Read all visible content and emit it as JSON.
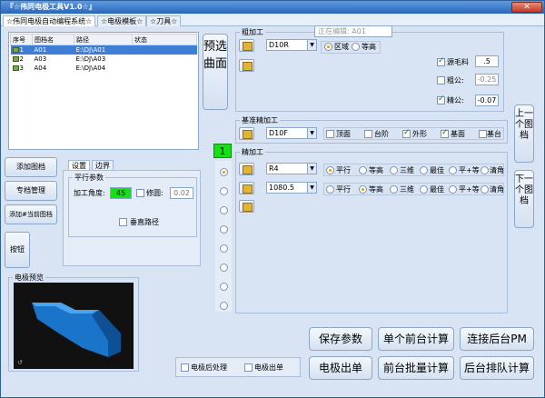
{
  "window": {
    "title": "『☆伟同电极工具V1.0☆』",
    "close": "✕"
  },
  "tabs": [
    "☆伟同电极自动编程系统☆",
    "☆电极模板☆",
    "☆刀具☆"
  ],
  "file_table": {
    "headers": [
      "序号",
      "图档名",
      "路径",
      "状态"
    ],
    "rows": [
      {
        "no": "1",
        "name": "A01",
        "path": "E:\\DJ\\A01",
        "status": ""
      },
      {
        "no": "2",
        "name": "A03",
        "path": "E:\\DJ\\A03",
        "status": ""
      },
      {
        "no": "3",
        "name": "A04",
        "path": "E:\\DJ\\A04",
        "status": ""
      }
    ]
  },
  "left_buttons": {
    "add": "添加图档",
    "manage": "专档管理",
    "add_current": "添加#当前图档",
    "button": "按钮"
  },
  "settings": {
    "tabs": [
      "设置",
      "边界"
    ],
    "group": "平行参数",
    "angle_label": "加工角度:",
    "angle_value": "45",
    "trim_label": "修圆:",
    "trim_value": "0.02",
    "vertical": "垂直路径"
  },
  "preview": {
    "label": "电极预览"
  },
  "preselect_button": "预选曲面",
  "step_number": "1",
  "rough": {
    "title": "粗加工",
    "editing": "正在编辑: A01",
    "tool": "D10R",
    "radio_area": "区域",
    "radio_contour": "等高",
    "stock_label": "源毛料",
    "stock_value": ".5",
    "rough_label": "粗公:",
    "rough_value": "-0.25",
    "fine_label": "精公:",
    "fine_value": "-0.07"
  },
  "base_finish": {
    "title": "基准精加工",
    "tool": "D10F",
    "options": [
      "顶面",
      "台阶",
      "外形",
      "基面",
      "基台"
    ]
  },
  "finish": {
    "title": "精加工",
    "tools": [
      "R4",
      "1080.5"
    ],
    "options": [
      "平行",
      "等高",
      "三维",
      "最佳",
      "平+等",
      "清角"
    ]
  },
  "nav": {
    "prev": "上一个图档",
    "next": "下一个图档"
  },
  "bottom_checks": {
    "post": "电极后处理",
    "sheet": "电极出单"
  },
  "actions": {
    "save": "保存参数",
    "single": "单个前台计算",
    "connect": "连接后台PM",
    "output": "电极出单",
    "batch": "前台批量计算",
    "queue": "后台排队计算"
  },
  "colors": {
    "accent_green": "#14e014",
    "selection": "#3d7fd6",
    "title_bar": "#2b66b8"
  }
}
